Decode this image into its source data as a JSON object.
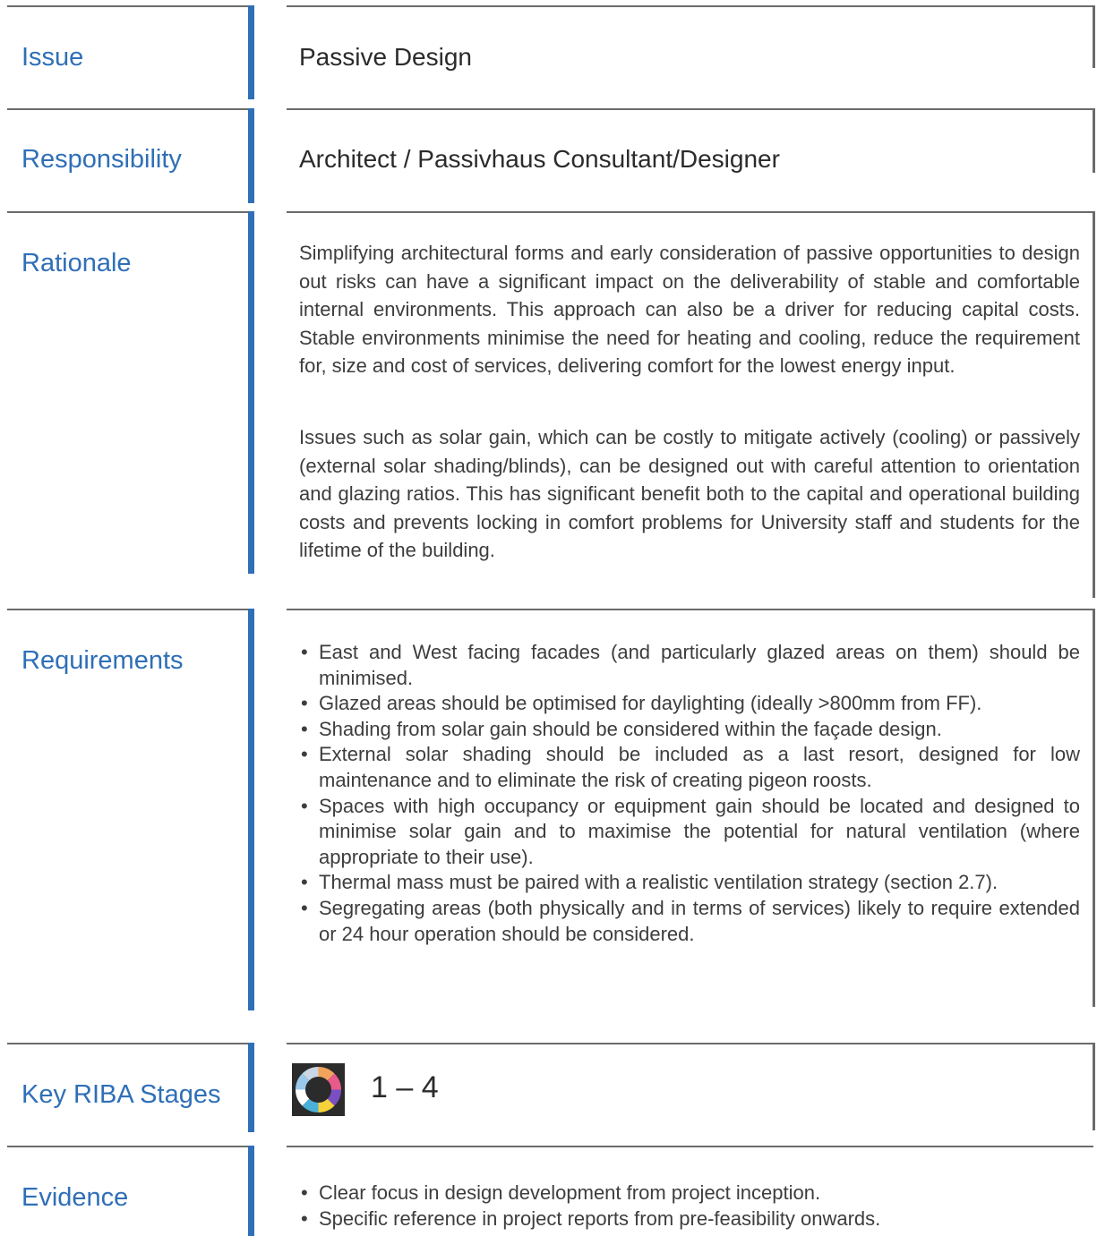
{
  "rows": {
    "issue": {
      "label": "Issue",
      "value": "Passive Design"
    },
    "responsibility": {
      "label": "Responsibility",
      "value": "Architect / Passivhaus Consultant/Designer"
    },
    "rationale": {
      "label": "Rationale",
      "paragraphs": [
        "Simplifying architectural forms and early consideration of passive opportunities to design out risks can have a significant impact on the deliverability of stable and comfortable internal environments.  This approach can also be a driver for reducing capital costs.  Stable environments minimise the need for heating and cooling, reduce the requirement for, size and cost of services, delivering comfort for the lowest energy input.",
        "Issues such as solar gain, which can be costly to mitigate actively (cooling) or passively (external solar shading/blinds), can be designed out with careful attention to orientation and glazing ratios.  This has significant benefit both to the capital and operational building costs and prevents locking in comfort problems for University staff and students for the lifetime of the building."
      ]
    },
    "requirements": {
      "label": "Requirements",
      "items": [
        "East and West facing facades (and particularly glazed areas on them) should be minimised.",
        "Glazed areas should be optimised for daylighting (ideally >800mm from FF).",
        "Shading from solar gain should be considered within the façade design.",
        "External solar shading should be included as a last resort, designed for low maintenance and to eliminate the risk of creating pigeon roosts.",
        "Spaces with high occupancy or equipment gain should be located and designed to minimise solar gain and to maximise the potential for natural ventilation (where appropriate to their use).",
        "Thermal mass must be paired with a realistic ventilation strategy (section 2.7).",
        "Segregating areas (both physically and in terms of services) likely to require extended or 24 hour operation should be considered."
      ]
    },
    "riba": {
      "label": "Key RIBA Stages",
      "icon": "riba-stages-wheel-icon",
      "value": "1 – 4"
    },
    "evidence": {
      "label": "Evidence",
      "items": [
        "Clear focus in design development from project inception.",
        "Specific reference in project reports from pre-feasibility onwards."
      ]
    }
  },
  "colors": {
    "accent": "#2f6fb7",
    "rule": "#6b6b6b",
    "text": "#3d3d3d"
  }
}
